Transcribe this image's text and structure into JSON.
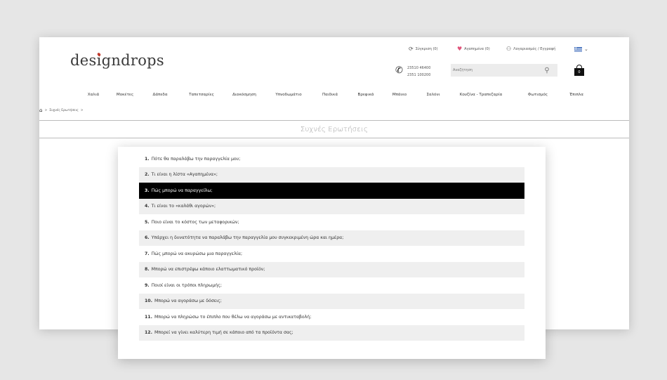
{
  "header": {
    "logo": {
      "pre": "des",
      "dot_letter": "i",
      "post": "gndrops"
    },
    "compare": "Σύγκριση (0)",
    "wishlist": "Αγαπημένα (0)",
    "account": "Λογαριασμός / Εγγραφή",
    "language_icon": "greek-flag-icon",
    "phones": [
      "23510 46400",
      "2351 100200"
    ],
    "search_placeholder": "Αναζήτηση",
    "cart_count": "0"
  },
  "nav": [
    "Χαλιά",
    "Μοκέτες",
    "Δάπεδα",
    "Ταπετσαρίες",
    "Διακόσμηση",
    "Υπνοδωμάτιο",
    "Παιδικά",
    "Βρεφικά",
    "Μπάνιο",
    "Σαλόνι",
    "Κουζίνα - Τραπεζαρία",
    "Φωτισμός",
    "Έπιπλα"
  ],
  "breadcrumb": {
    "current": "Συχνές Ερωτήσεις",
    "separator": ">"
  },
  "page_title": "Συχνές Ερωτήσεις",
  "faq": [
    {
      "num": "1.",
      "text": "Πότε θα παραλάβω την παραγγελία μου;"
    },
    {
      "num": "2.",
      "text": "Τι είναι η λίστα «Αγαπημένα»;"
    },
    {
      "num": "3.",
      "text": "Πώς μπορώ να παραγγείλω;"
    },
    {
      "num": "4.",
      "text": "Τι είναι το «καλάθι αγορών»;"
    },
    {
      "num": "5.",
      "text": "Ποιο είναι το κόστος των μεταφορικών;"
    },
    {
      "num": "6.",
      "text": "Υπάρχει η δυνατότητα να παραλάβω την παραγγελία μου συγκεκριμένη ώρα και ημέρα;"
    },
    {
      "num": "7.",
      "text": "Πώς μπορώ να ακυρώσω μια παραγγελία;"
    },
    {
      "num": "8.",
      "text": "Μπορώ να επιστρέψω κάποιο ελαττωματικό προϊόν;"
    },
    {
      "num": "9.",
      "text": "Ποιοί είναι οι τρόποι πληρωμής;"
    },
    {
      "num": "10.",
      "text": "Μπορώ να αγοράσω με δόσεις;"
    },
    {
      "num": "11.",
      "text": "Μπορώ να πληρώσω το έπιπλο που θέλω να αγοράσω με αντικαταβολή;"
    },
    {
      "num": "12.",
      "text": "Μπορεί να γίνει καλύτερη τιμή σε κάποιο από τα προϊόντα σας;"
    }
  ],
  "active_faq_index": 2,
  "colors": {
    "active_row": "#000000",
    "alt_row": "#efefef",
    "wishlist_heart": "#e0537a",
    "logo_dot": "#c0392b"
  }
}
